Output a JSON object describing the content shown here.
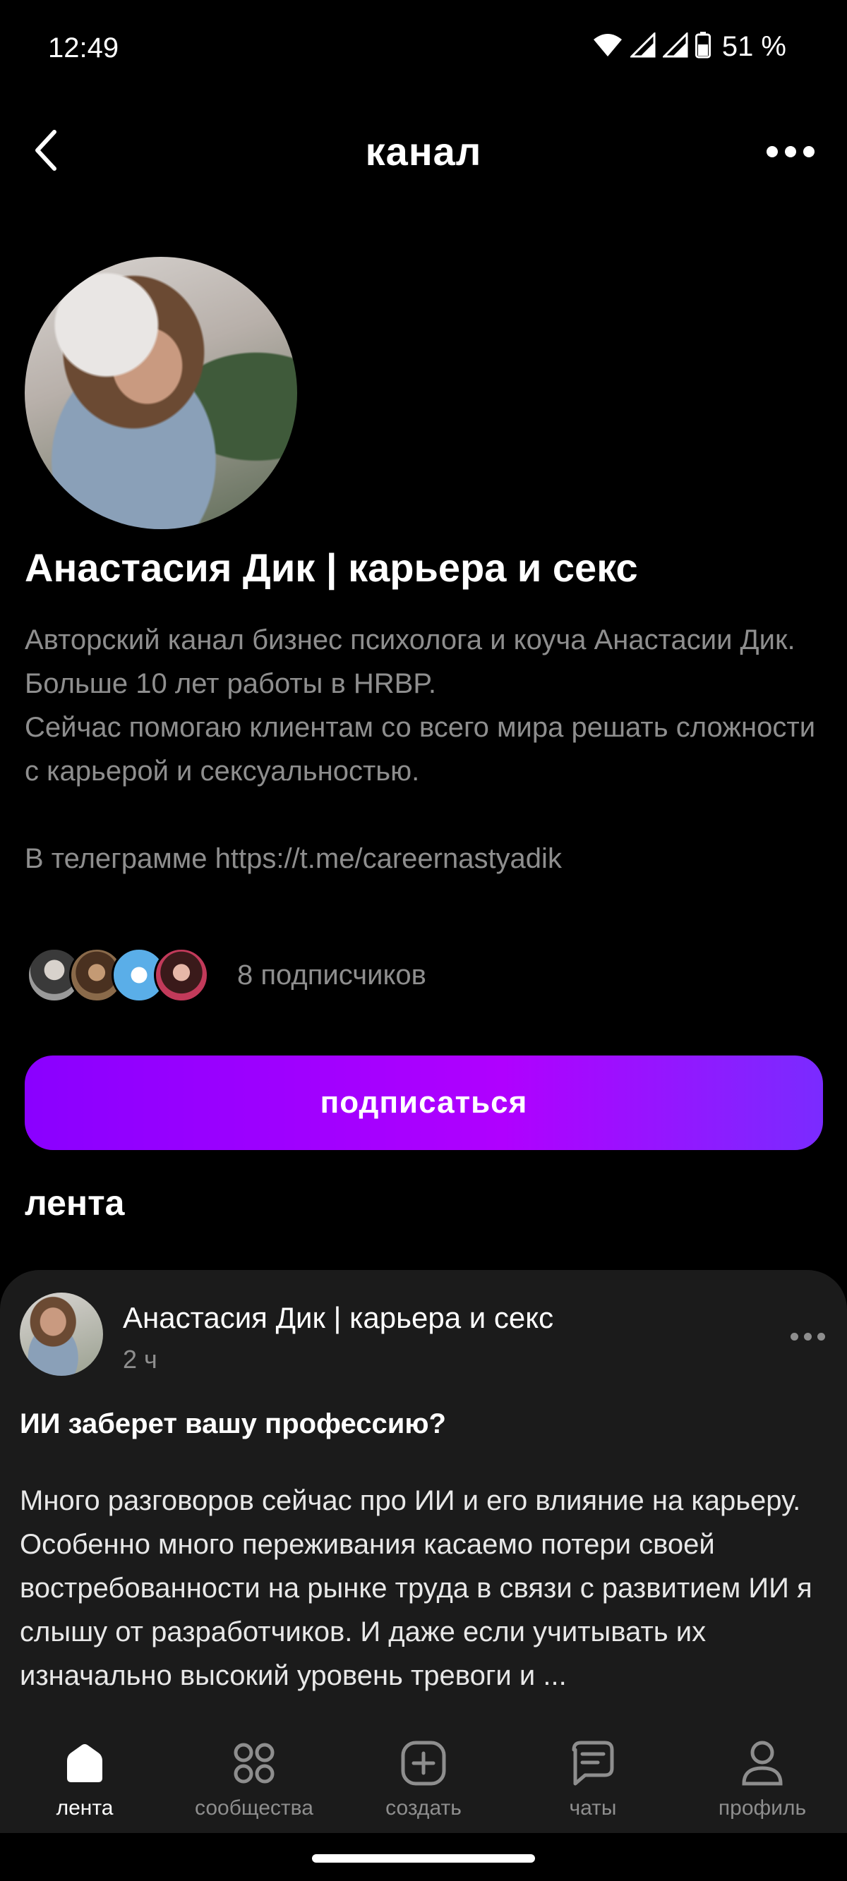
{
  "status_bar": {
    "time": "12:49",
    "battery_percent": "51 %",
    "icons": [
      "wifi-icon",
      "signal-icon",
      "signal-icon",
      "battery-icon"
    ]
  },
  "top_nav": {
    "back_icon": "chevron-left-icon",
    "title": "канал",
    "more_icon": "more-horizontal-icon"
  },
  "channel": {
    "name": "Анастасия Дик | карьера и секс",
    "description": {
      "line1": "Авторский канал бизнес психолога и коуча Анастасии Дик. Больше 10 лет работы в HRBP.",
      "line2": "Сейчас помогаю клиентам со всего мира решать сложности с карьерой и сексуальностью.",
      "line3": "В телеграмме https://t.me/careernastyadik"
    },
    "subscribers_text": "8 подписчиков",
    "subscribe_label": "подписаться"
  },
  "feed": {
    "section_title": "лента",
    "post": {
      "author": "Анастасия Дик | карьера и секс",
      "time": "2 ч",
      "title": "ИИ заберет вашу профессию?",
      "text": "Много разговоров сейчас про ИИ и его влияние на карьеру. Особенно много переживания касаемо потери своей востребованности на рынке труда в связи с развитием ИИ я слышу от разработчиков. И даже если учитывать их изначально высокий уровень тревоги и ..."
    }
  },
  "bottom_nav": {
    "items": [
      {
        "label": "лента",
        "icon": "home-icon",
        "active": true
      },
      {
        "label": "сообщества",
        "icon": "grid-icon",
        "active": false
      },
      {
        "label": "создать",
        "icon": "plus-square-icon",
        "active": false
      },
      {
        "label": "чаты",
        "icon": "chat-icon",
        "active": false
      },
      {
        "label": "профиль",
        "icon": "profile-icon",
        "active": false
      }
    ]
  },
  "colors": {
    "background": "#000000",
    "card": "#1b1b1b",
    "muted_text": "#8e8e8e",
    "accent_gradient_start": "#8a00ff",
    "accent_gradient_end": "#7a2bff"
  }
}
